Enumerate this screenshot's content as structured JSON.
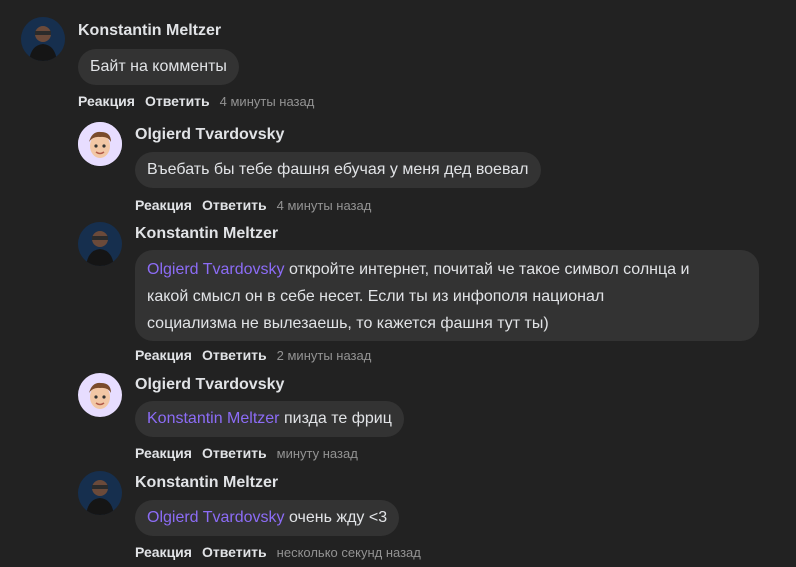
{
  "comments": [
    {
      "author": "Konstantin Meltzer",
      "avatar_icon": "photo-avatar-icon",
      "mention": "",
      "text": "Байт на комменты",
      "react_label": "Реакция",
      "reply_label": "Ответить",
      "time": "4 минуты назад"
    },
    {
      "author": "Olgierd Tvardovsky",
      "avatar_icon": "memoji-avatar-icon",
      "mention": "",
      "text": "Въебать бы тебе фашня ебучая у меня дед воевал",
      "react_label": "Реакция",
      "reply_label": "Ответить",
      "time": "4 минуты назад"
    },
    {
      "author": "Konstantin Meltzer",
      "avatar_icon": "photo-avatar-icon",
      "mention": "Olgierd Tvardovsky",
      "text_line1": "откройте интернет, почитай че такое символ солнца и",
      "text_line2": "какой смысл он в себе несет. Если ты из инфополя национал",
      "text_line3": "социализма не вылезаешь, то кажется фашня тут ты)",
      "react_label": "Реакция",
      "reply_label": "Ответить",
      "time": "2 минуты назад"
    },
    {
      "author": "Olgierd Tvardovsky",
      "avatar_icon": "memoji-avatar-icon",
      "mention": "Konstantin Meltzer",
      "text": "пизда те фриц",
      "react_label": "Реакция",
      "reply_label": "Ответить",
      "time": "минуту назад"
    },
    {
      "author": "Konstantin Meltzer",
      "avatar_icon": "photo-avatar-icon",
      "mention": "Olgierd Tvardovsky",
      "text": "очень жду <3",
      "react_label": "Реакция",
      "reply_label": "Ответить",
      "time": "несколько секунд назад"
    }
  ],
  "colors": {
    "background": "#222222",
    "bubble": "#333333",
    "mention": "#8c6cf6",
    "muted": "#939393"
  }
}
